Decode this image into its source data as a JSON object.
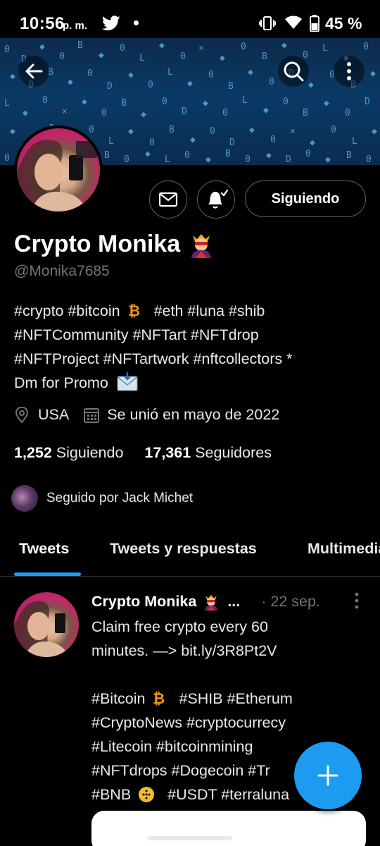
{
  "status_bar": {
    "time": "10:56",
    "ampm": "p. m.",
    "battery": "45 %"
  },
  "header": {
    "back_icon": "arrow-left-icon",
    "search_icon": "search-icon",
    "more_icon": "more-vertical-icon"
  },
  "profile": {
    "name": "Crypto Monika",
    "handle": "@Monika7685",
    "bio_lines": [
      "#crypto #bitcoin",
      "#NFTCommunity #NFTart #NFTdrop",
      "#NFTProject #NFTartwork #nftcollectors *",
      "Dm for Promo"
    ],
    "bio_line1_rest": "#eth #luna #shib",
    "location": "USA",
    "joined": "Se unió en mayo de 2022",
    "following_count": "1,252",
    "following_label": "Siguiendo",
    "followers_count": "17,361",
    "followers_label": "Seguidores",
    "followed_by": "Seguido por Jack Michet"
  },
  "actions": {
    "follow_label": "Siguiendo",
    "message_icon": "envelope-icon",
    "notify_icon": "bell-check-icon"
  },
  "tabs": [
    {
      "label": "Tweets",
      "active": true
    },
    {
      "label": "Tweets y respuestas",
      "active": false
    },
    {
      "label": "Multimedia",
      "active": false
    }
  ],
  "tweet": {
    "name": "Crypto Monika",
    "ellipsis": "...",
    "date": "· 22 sep.",
    "lines": [
      "Claim free crypto every 60",
      "minutes. —> bit.ly/3R8Pt2V",
      "",
      "#Bitcoin",
      "#CryptoNews #cryptocurrecy",
      "#Litecoin #bitcoinmining",
      "#NFTdrops #Dogecoin #Tr",
      "#BNB"
    ],
    "line4_rest": "#SHIB #Etherum",
    "line8_rest": "#USDT #terraluna"
  },
  "colors": {
    "accent": "#1d9bf0",
    "muted": "#71767b",
    "border": "#536471",
    "bitcoin": "#f7931a"
  }
}
